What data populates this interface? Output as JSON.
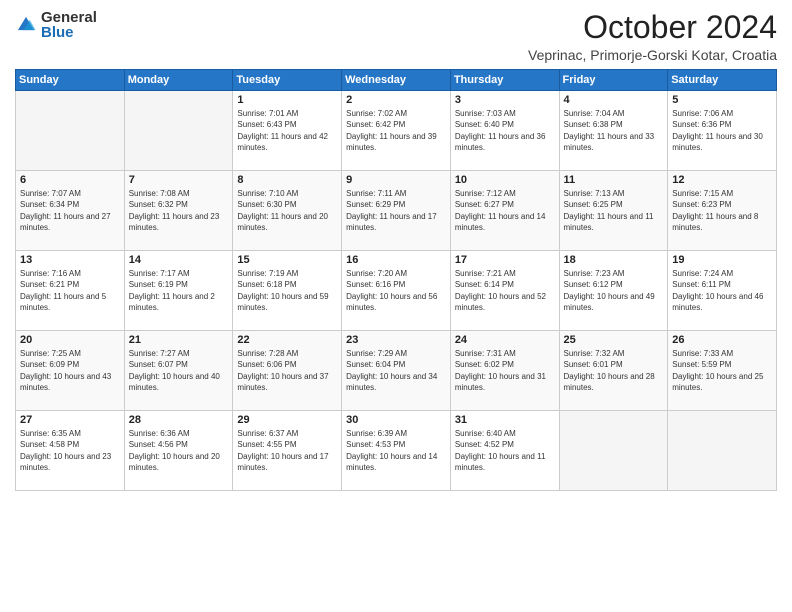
{
  "header": {
    "logo_general": "General",
    "logo_blue": "Blue",
    "month_title": "October 2024",
    "location": "Veprinac, Primorje-Gorski Kotar, Croatia"
  },
  "columns": [
    "Sunday",
    "Monday",
    "Tuesday",
    "Wednesday",
    "Thursday",
    "Friday",
    "Saturday"
  ],
  "weeks": [
    [
      {
        "day": "",
        "sunrise": "",
        "sunset": "",
        "daylight": ""
      },
      {
        "day": "",
        "sunrise": "",
        "sunset": "",
        "daylight": ""
      },
      {
        "day": "1",
        "sunrise": "Sunrise: 7:01 AM",
        "sunset": "Sunset: 6:43 PM",
        "daylight": "Daylight: 11 hours and 42 minutes."
      },
      {
        "day": "2",
        "sunrise": "Sunrise: 7:02 AM",
        "sunset": "Sunset: 6:42 PM",
        "daylight": "Daylight: 11 hours and 39 minutes."
      },
      {
        "day": "3",
        "sunrise": "Sunrise: 7:03 AM",
        "sunset": "Sunset: 6:40 PM",
        "daylight": "Daylight: 11 hours and 36 minutes."
      },
      {
        "day": "4",
        "sunrise": "Sunrise: 7:04 AM",
        "sunset": "Sunset: 6:38 PM",
        "daylight": "Daylight: 11 hours and 33 minutes."
      },
      {
        "day": "5",
        "sunrise": "Sunrise: 7:06 AM",
        "sunset": "Sunset: 6:36 PM",
        "daylight": "Daylight: 11 hours and 30 minutes."
      }
    ],
    [
      {
        "day": "6",
        "sunrise": "Sunrise: 7:07 AM",
        "sunset": "Sunset: 6:34 PM",
        "daylight": "Daylight: 11 hours and 27 minutes."
      },
      {
        "day": "7",
        "sunrise": "Sunrise: 7:08 AM",
        "sunset": "Sunset: 6:32 PM",
        "daylight": "Daylight: 11 hours and 23 minutes."
      },
      {
        "day": "8",
        "sunrise": "Sunrise: 7:10 AM",
        "sunset": "Sunset: 6:30 PM",
        "daylight": "Daylight: 11 hours and 20 minutes."
      },
      {
        "day": "9",
        "sunrise": "Sunrise: 7:11 AM",
        "sunset": "Sunset: 6:29 PM",
        "daylight": "Daylight: 11 hours and 17 minutes."
      },
      {
        "day": "10",
        "sunrise": "Sunrise: 7:12 AM",
        "sunset": "Sunset: 6:27 PM",
        "daylight": "Daylight: 11 hours and 14 minutes."
      },
      {
        "day": "11",
        "sunrise": "Sunrise: 7:13 AM",
        "sunset": "Sunset: 6:25 PM",
        "daylight": "Daylight: 11 hours and 11 minutes."
      },
      {
        "day": "12",
        "sunrise": "Sunrise: 7:15 AM",
        "sunset": "Sunset: 6:23 PM",
        "daylight": "Daylight: 11 hours and 8 minutes."
      }
    ],
    [
      {
        "day": "13",
        "sunrise": "Sunrise: 7:16 AM",
        "sunset": "Sunset: 6:21 PM",
        "daylight": "Daylight: 11 hours and 5 minutes."
      },
      {
        "day": "14",
        "sunrise": "Sunrise: 7:17 AM",
        "sunset": "Sunset: 6:19 PM",
        "daylight": "Daylight: 11 hours and 2 minutes."
      },
      {
        "day": "15",
        "sunrise": "Sunrise: 7:19 AM",
        "sunset": "Sunset: 6:18 PM",
        "daylight": "Daylight: 10 hours and 59 minutes."
      },
      {
        "day": "16",
        "sunrise": "Sunrise: 7:20 AM",
        "sunset": "Sunset: 6:16 PM",
        "daylight": "Daylight: 10 hours and 56 minutes."
      },
      {
        "day": "17",
        "sunrise": "Sunrise: 7:21 AM",
        "sunset": "Sunset: 6:14 PM",
        "daylight": "Daylight: 10 hours and 52 minutes."
      },
      {
        "day": "18",
        "sunrise": "Sunrise: 7:23 AM",
        "sunset": "Sunset: 6:12 PM",
        "daylight": "Daylight: 10 hours and 49 minutes."
      },
      {
        "day": "19",
        "sunrise": "Sunrise: 7:24 AM",
        "sunset": "Sunset: 6:11 PM",
        "daylight": "Daylight: 10 hours and 46 minutes."
      }
    ],
    [
      {
        "day": "20",
        "sunrise": "Sunrise: 7:25 AM",
        "sunset": "Sunset: 6:09 PM",
        "daylight": "Daylight: 10 hours and 43 minutes."
      },
      {
        "day": "21",
        "sunrise": "Sunrise: 7:27 AM",
        "sunset": "Sunset: 6:07 PM",
        "daylight": "Daylight: 10 hours and 40 minutes."
      },
      {
        "day": "22",
        "sunrise": "Sunrise: 7:28 AM",
        "sunset": "Sunset: 6:06 PM",
        "daylight": "Daylight: 10 hours and 37 minutes."
      },
      {
        "day": "23",
        "sunrise": "Sunrise: 7:29 AM",
        "sunset": "Sunset: 6:04 PM",
        "daylight": "Daylight: 10 hours and 34 minutes."
      },
      {
        "day": "24",
        "sunrise": "Sunrise: 7:31 AM",
        "sunset": "Sunset: 6:02 PM",
        "daylight": "Daylight: 10 hours and 31 minutes."
      },
      {
        "day": "25",
        "sunrise": "Sunrise: 7:32 AM",
        "sunset": "Sunset: 6:01 PM",
        "daylight": "Daylight: 10 hours and 28 minutes."
      },
      {
        "day": "26",
        "sunrise": "Sunrise: 7:33 AM",
        "sunset": "Sunset: 5:59 PM",
        "daylight": "Daylight: 10 hours and 25 minutes."
      }
    ],
    [
      {
        "day": "27",
        "sunrise": "Sunrise: 6:35 AM",
        "sunset": "Sunset: 4:58 PM",
        "daylight": "Daylight: 10 hours and 23 minutes."
      },
      {
        "day": "28",
        "sunrise": "Sunrise: 6:36 AM",
        "sunset": "Sunset: 4:56 PM",
        "daylight": "Daylight: 10 hours and 20 minutes."
      },
      {
        "day": "29",
        "sunrise": "Sunrise: 6:37 AM",
        "sunset": "Sunset: 4:55 PM",
        "daylight": "Daylight: 10 hours and 17 minutes."
      },
      {
        "day": "30",
        "sunrise": "Sunrise: 6:39 AM",
        "sunset": "Sunset: 4:53 PM",
        "daylight": "Daylight: 10 hours and 14 minutes."
      },
      {
        "day": "31",
        "sunrise": "Sunrise: 6:40 AM",
        "sunset": "Sunset: 4:52 PM",
        "daylight": "Daylight: 10 hours and 11 minutes."
      },
      {
        "day": "",
        "sunrise": "",
        "sunset": "",
        "daylight": ""
      },
      {
        "day": "",
        "sunrise": "",
        "sunset": "",
        "daylight": ""
      }
    ]
  ]
}
